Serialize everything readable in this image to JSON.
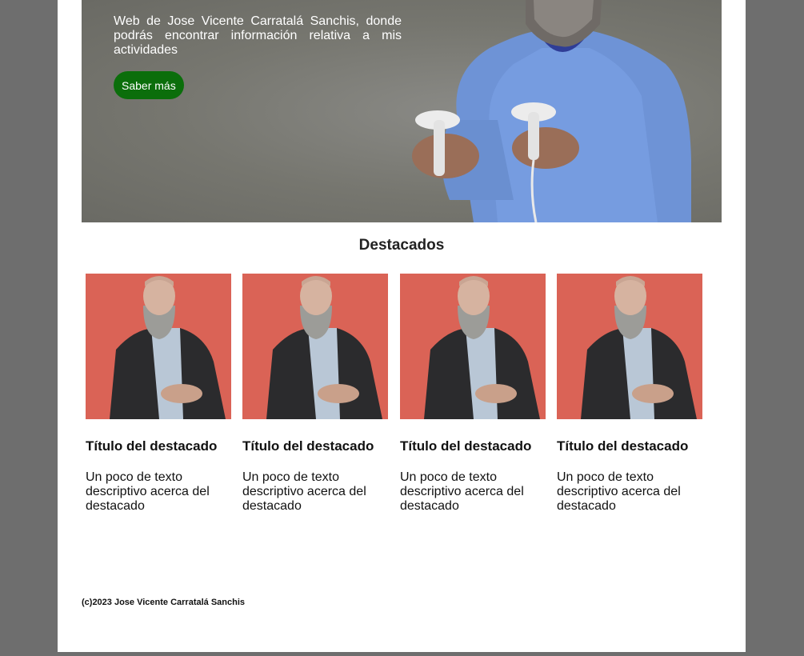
{
  "hero": {
    "description": "Web de Jose Vicente Carratalá Sanchis, donde podrás encontrar información relativa a mis actividades",
    "button_label": "Saber más"
  },
  "featured": {
    "title": "Destacados",
    "items": [
      {
        "title": "Título del destacado",
        "description": "Un poco de texto descriptivo acerca del destacado"
      },
      {
        "title": "Título del destacado",
        "description": "Un poco de texto descriptivo acerca del destacado"
      },
      {
        "title": "Título del destacado",
        "description": "Un poco de texto descriptivo acerca del destacado"
      },
      {
        "title": "Título del destacado",
        "description": "Un poco de texto descriptivo acerca del destacado"
      }
    ]
  },
  "footer": {
    "copyright": "(c)2023 Jose Vicente Carratalá Sanchis"
  },
  "colors": {
    "page_background": "#6e6e6e",
    "content_background": "#ffffff",
    "button_green": "#0b6e0b",
    "thumbnail_background": "#e06a5c"
  }
}
